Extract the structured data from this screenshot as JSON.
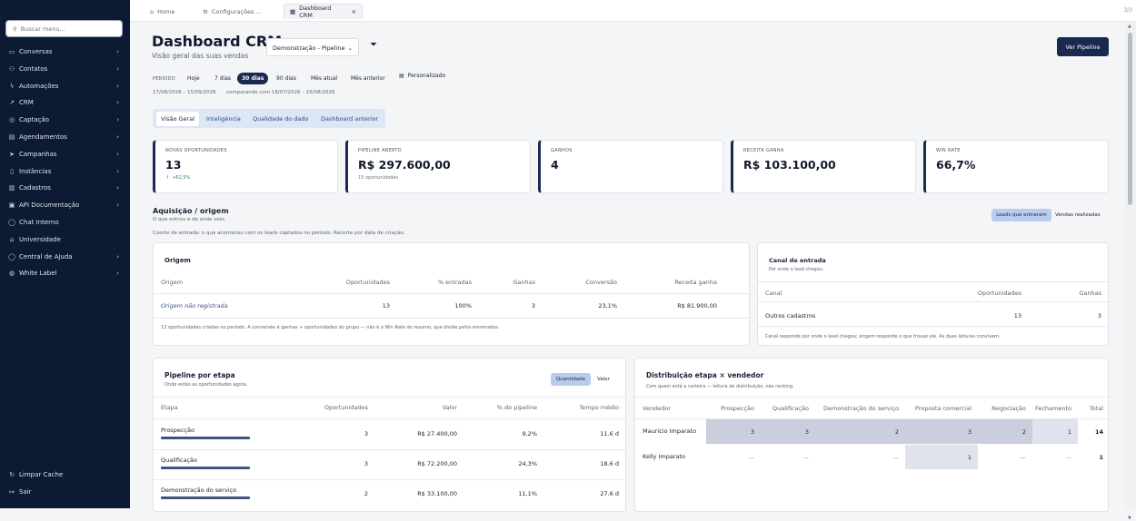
{
  "sidebar": {
    "search_placeholder": "Buscar menu...",
    "items": [
      {
        "label": "Conversas",
        "icon": "chat-icon",
        "glyph": "▭",
        "chevron": true
      },
      {
        "label": "Contatos",
        "icon": "contacts-icon",
        "glyph": "⚇",
        "chevron": true
      },
      {
        "label": "Automações",
        "icon": "bolt-icon",
        "glyph": "ϟ",
        "chevron": true
      },
      {
        "label": "CRM",
        "icon": "trend-icon",
        "glyph": "↗",
        "chevron": true
      },
      {
        "label": "Captação",
        "icon": "target-icon",
        "glyph": "◎",
        "chevron": true
      },
      {
        "label": "Agendamentos",
        "icon": "calendar-icon",
        "glyph": "▤",
        "chevron": true
      },
      {
        "label": "Campanhas",
        "icon": "send-icon",
        "glyph": "➤",
        "chevron": true
      },
      {
        "label": "Instâncias",
        "icon": "phone-icon",
        "glyph": "▯",
        "chevron": true
      },
      {
        "label": "Cadastros",
        "icon": "database-icon",
        "glyph": "▥",
        "chevron": true
      },
      {
        "label": "API Documentação",
        "icon": "book-icon",
        "glyph": "▣",
        "chevron": true
      },
      {
        "label": "Chat Interno",
        "icon": "message-icon",
        "glyph": "◯",
        "chevron": false
      },
      {
        "label": "Universidade",
        "icon": "graduation-icon",
        "glyph": "⌂",
        "chevron": false
      },
      {
        "label": "Central de Ajuda",
        "icon": "help-icon",
        "glyph": "◯",
        "chevron": true
      },
      {
        "label": "White Label",
        "icon": "palette-icon",
        "glyph": "◍",
        "chevron": true
      }
    ],
    "footer": [
      {
        "label": "Limpar Cache",
        "icon": "refresh-icon",
        "glyph": "↻"
      },
      {
        "label": "Sair",
        "icon": "logout-icon",
        "glyph": "↦"
      }
    ]
  },
  "tabs": [
    {
      "label": "Home",
      "icon": "home-icon",
      "glyph": "⌂"
    },
    {
      "label": "Configurações ...",
      "icon": "gear-icon",
      "glyph": "⚙"
    },
    {
      "label": "Dashboard CRM",
      "icon": "grid-icon",
      "glyph": "▦",
      "close": "×"
    }
  ],
  "tab_counter": "3/3",
  "header": {
    "title": "Dashboard CRM",
    "subtitle": "Visão geral das suas vendas",
    "pipeline_select": "Demonstração - Pipeline",
    "cta": "Ver Pipeline"
  },
  "period": {
    "label": "PERÍODO",
    "options": [
      "Hoje",
      "7 dias",
      "30 dias",
      "90 dias",
      "Mês atual",
      "Mês anterior"
    ],
    "selected": "30 dias",
    "custom": "Personalizado",
    "range": "17/08/2026 – 15/09/2026",
    "compare": "comparando com 18/07/2026 – 16/08/2026"
  },
  "view_tabs": [
    "Visão Geral",
    "Inteligência",
    "Qualidade do dado",
    "Dashboard anterior"
  ],
  "kpis": [
    {
      "label": "NOVAS OPORTUNIDADES",
      "value": "13",
      "sub": "+62,5%",
      "sub_positive": true
    },
    {
      "label": "PIPELINE ABERTO",
      "value": "R$ 297.600,00",
      "sub": "15 oportunidades"
    },
    {
      "label": "GANHOS",
      "value": "4",
      "sub": ""
    },
    {
      "label": "RECEITA GANHA",
      "value": "R$ 103.100,00",
      "sub": ""
    },
    {
      "label": "WIN RATE",
      "value": "66,7%",
      "sub": ""
    }
  ],
  "acquisition": {
    "title": "Aquisição / origem",
    "subtitle": "O que entrou e de onde veio.",
    "toggle": [
      "Leads que entraram",
      "Vendas realizadas"
    ],
    "note": "Coorte de entrada: o que aconteceu com os leads captados no período. Recorte por data de criação.",
    "origem": {
      "title": "Origem",
      "columns": [
        "Origem",
        "Oportunidades",
        "% entradas",
        "Ganhas",
        "Conversão",
        "Receita ganha"
      ],
      "rows": [
        [
          "Origem não registrada",
          "13",
          "100%",
          "3",
          "23,1%",
          "R$ 81.900,00"
        ]
      ],
      "footnote": "13 oportunidades criadas no período. A conversão é ganhas ÷ oportunidades do grupo — não é o Win Rate do resumo, que divide pelos encerrados."
    },
    "canal": {
      "title": "Canal de entrada",
      "subtitle": "Por onde o lead chegou.",
      "columns": [
        "Canal",
        "Oportunidades",
        "Ganhas"
      ],
      "rows": [
        [
          "Outros cadastros",
          "13",
          "3"
        ]
      ],
      "footnote": "Canal responde por onde o lead chegou; origem responde o que trouxe ele. As duas leituras convivem."
    }
  },
  "pipeline": {
    "title": "Pipeline por etapa",
    "subtitle": "Onde estão as oportunidades agora.",
    "toggle": [
      "Quantidade",
      "Valor"
    ],
    "columns": [
      "Etapa",
      "Oportunidades",
      "Valor",
      "% do pipeline",
      "Tempo médio"
    ],
    "rows": [
      {
        "etapa": "Prospecção",
        "ops": "3",
        "valor": "R$ 27.400,00",
        "pct": "9,2%",
        "tempo": "11.6 d",
        "bar": 0.3
      },
      {
        "etapa": "Qualificação",
        "ops": "3",
        "valor": "R$ 72.200,00",
        "pct": "24,3%",
        "tempo": "18.6 d",
        "bar": 0.3
      },
      {
        "etapa": "Demonstração do serviço",
        "ops": "2",
        "valor": "R$ 33.100,00",
        "pct": "11,1%",
        "tempo": "27.6 d",
        "bar": 0.3
      }
    ]
  },
  "distribution": {
    "title": "Distribuição etapa × vendedor",
    "subtitle": "Com quem está a carteira — leitura de distribuição, não ranking.",
    "columns": [
      "Vendedor",
      "Prospecção",
      "Qualificação",
      "Demonstração do serviço",
      "Proposta comercial",
      "Negociação",
      "Fechamento",
      "Total"
    ],
    "rows": [
      {
        "vendedor": "Mauricio Imparato",
        "cells": [
          "3",
          "3",
          "2",
          "3",
          "2",
          "1"
        ],
        "total": "14"
      },
      {
        "vendedor": "Kelly Imparato",
        "cells": [
          "—",
          "—",
          "—",
          "1",
          "—",
          "—"
        ],
        "total": "1"
      }
    ]
  }
}
